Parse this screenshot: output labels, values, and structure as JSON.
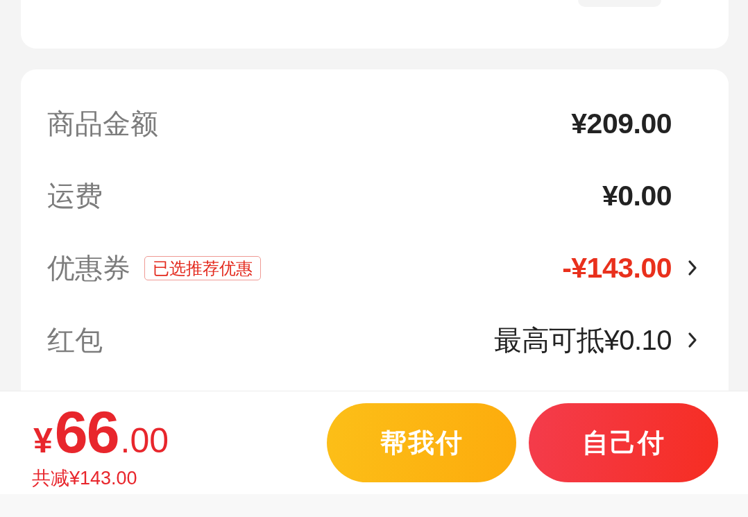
{
  "summary": {
    "rows": [
      {
        "kind": "amount",
        "label": "商品金额",
        "value": "¥209.00",
        "chevron": false
      },
      {
        "kind": "amount",
        "label": "运费",
        "value": "¥0.00",
        "chevron": false
      },
      {
        "kind": "discount",
        "label": "优惠券",
        "tag": "已选推荐优惠",
        "value": "-¥143.00",
        "chevron": true
      },
      {
        "kind": "offer",
        "label": "红包",
        "value": "最高可抵¥0.10",
        "chevron": true
      }
    ]
  },
  "footer": {
    "total": {
      "currency": "¥",
      "integer": "66",
      "fraction": ".00"
    },
    "savings": "共减¥143.00",
    "buttons": [
      {
        "kind": "secondary",
        "label": "帮我付"
      },
      {
        "kind": "primary",
        "label": "自己付"
      }
    ]
  }
}
